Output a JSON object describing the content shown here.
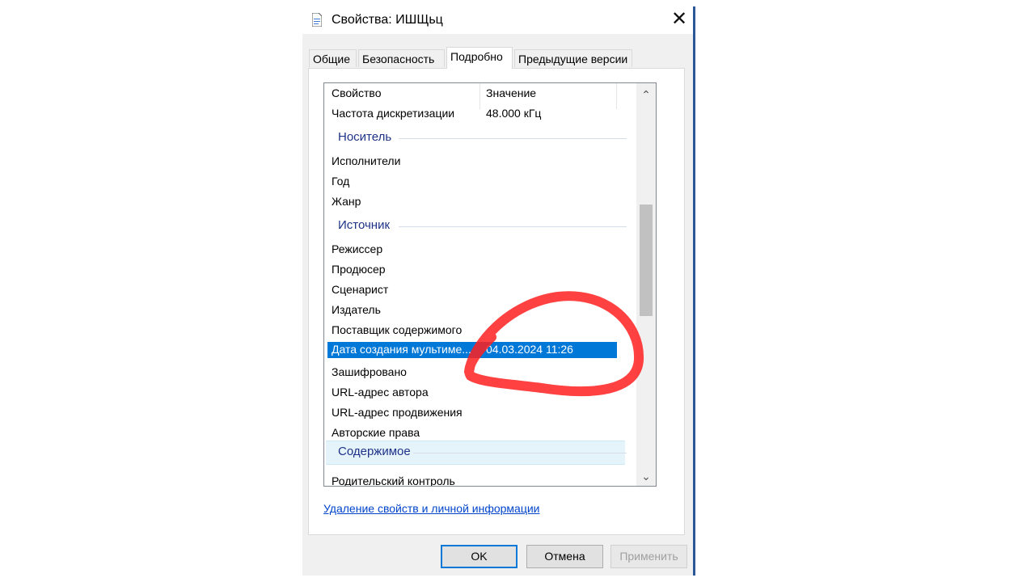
{
  "window": {
    "title": "Свойства: ИШЩьц",
    "close_glyph": "✕"
  },
  "tabs": [
    {
      "label": "Общие",
      "active": false
    },
    {
      "label": "Безопасность",
      "active": false
    },
    {
      "label": "Подробно",
      "active": true
    },
    {
      "label": "Предыдущие версии",
      "active": false
    }
  ],
  "list": {
    "header": {
      "property": "Свойство",
      "value": "Значение"
    },
    "top_row": {
      "name": "Частота дискретизации",
      "value": "48.000 кГц"
    },
    "groups": {
      "media": "Носитель",
      "source": "Источник",
      "content": "Содержимое"
    },
    "media_rows": [
      "Исполнители",
      "Год",
      "Жанр"
    ],
    "source_rows": [
      "Режиссер",
      "Продюсер",
      "Сценарист",
      "Издатель",
      "Поставщик содержимого"
    ],
    "selected": {
      "name": "Дата создания мультиме...",
      "value": "04.03.2024 11:26"
    },
    "after_rows": [
      "Зашифровано",
      "URL-адрес автора",
      "URL-адрес продвижения",
      "Авторские права"
    ],
    "partial_row": "Родительский контроль"
  },
  "link_text": "Удаление свойств и личной информации",
  "buttons": {
    "ok": "OK",
    "cancel": "Отмена",
    "apply": "Применить"
  },
  "colors": {
    "selection": "#0078d7",
    "group_text": "#1e3287",
    "annotation": "#ff2020",
    "link": "#0044cc"
  }
}
